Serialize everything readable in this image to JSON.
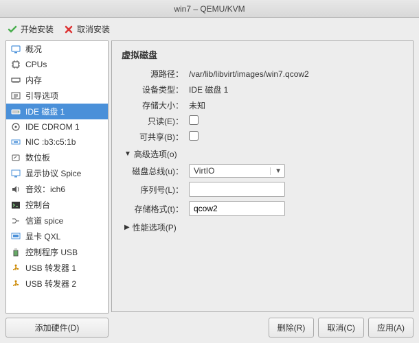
{
  "title": "win7 – QEMU/KVM",
  "toolbar": {
    "begin_install": "开始安装",
    "cancel_install": "取消安装"
  },
  "sidebar": {
    "items": [
      {
        "label": "概况",
        "icon": "monitor"
      },
      {
        "label": "CPUs",
        "icon": "cpu"
      },
      {
        "label": "内存",
        "icon": "memory"
      },
      {
        "label": "引导选项",
        "icon": "boot"
      },
      {
        "label": "IDE 磁盘 1",
        "icon": "disk",
        "selected": true
      },
      {
        "label": "IDE CDROM 1",
        "icon": "cdrom"
      },
      {
        "label": "NIC :b3:c5:1b",
        "icon": "nic"
      },
      {
        "label": "数位板",
        "icon": "tablet"
      },
      {
        "label": "显示协议 Spice",
        "icon": "display"
      },
      {
        "label": "音效：ich6",
        "icon": "sound"
      },
      {
        "label": "控制台",
        "icon": "console"
      },
      {
        "label": "信道 spice",
        "icon": "channel"
      },
      {
        "label": "显卡  QXL",
        "icon": "video"
      },
      {
        "label": "控制程序 USB",
        "icon": "usb"
      },
      {
        "label": "USB 转发器 1",
        "icon": "usbredir"
      },
      {
        "label": "USB 转发器 2",
        "icon": "usbredir"
      }
    ],
    "add_hardware": "添加硬件(D)"
  },
  "panel": {
    "title": "虚拟磁盘",
    "source_label": "源路径：",
    "source_value": "/var/lib/libvirt/images/win7.qcow2",
    "device_type_label": "设备类型：",
    "device_type_value": "IDE 磁盘 1",
    "size_label": "存储大小：",
    "size_value": "未知",
    "readonly_label": "只读(E)：",
    "shareable_label": "可共享(B)：",
    "adv_label": "高级选项(o)",
    "bus_label": "磁盘总线(u)：",
    "bus_value": "VirtIO",
    "serial_label": "序列号(L)：",
    "serial_value": "",
    "format_label": "存储格式(t)：",
    "format_value": "qcow2",
    "perf_label": "性能选项(P)"
  },
  "footer": {
    "remove": "删除(R)",
    "cancel": "取消(C)",
    "apply": "应用(A)"
  }
}
